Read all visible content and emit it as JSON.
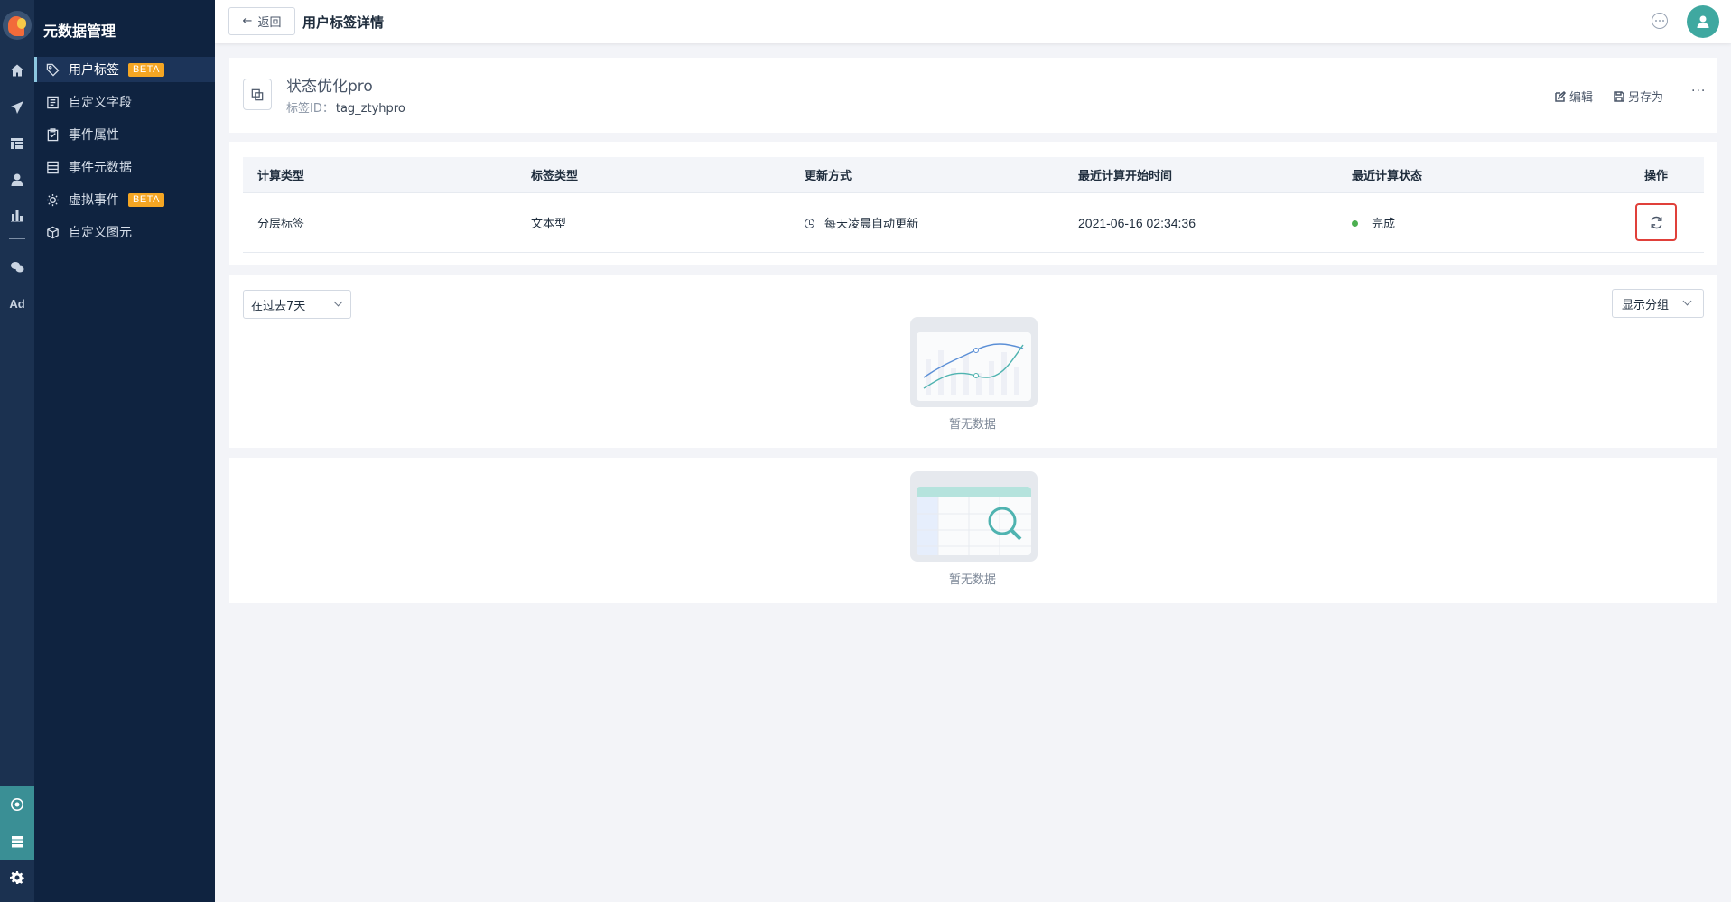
{
  "rail": {
    "icons": [
      "home-icon",
      "send-icon",
      "table-icon",
      "user-icon",
      "bar-chart-icon",
      "wechat-icon",
      "ad-icon"
    ],
    "ad_label": "Ad",
    "bottom_icons": [
      "cluster-icon",
      "server-icon",
      "settings-icon"
    ],
    "colors": {
      "bg": "#1b3150",
      "active_bottom": "#3a8f95"
    }
  },
  "sidebar": {
    "title": "元数据管理",
    "items": [
      {
        "label": "用户标签",
        "badge": "BETA",
        "active": true,
        "icon": "tag-icon"
      },
      {
        "label": "自定义字段",
        "badge": "",
        "active": false,
        "icon": "form-icon"
      },
      {
        "label": "事件属性",
        "badge": "",
        "active": false,
        "icon": "clipboard-icon"
      },
      {
        "label": "事件元数据",
        "badge": "",
        "active": false,
        "icon": "list-icon"
      },
      {
        "label": "虚拟事件",
        "badge": "BETA",
        "active": false,
        "icon": "virtual-icon"
      },
      {
        "label": "自定义图元",
        "badge": "",
        "active": false,
        "icon": "cube-icon"
      }
    ]
  },
  "header": {
    "back_label": "返回",
    "title": "用户标签详情"
  },
  "tag": {
    "name": "状态优化pro",
    "id_label": "标签ID：",
    "id_value": "tag_ztyhpro",
    "edit_label": "编辑",
    "save_as_label": "另存为",
    "more_label": "···"
  },
  "table": {
    "headers": [
      "计算类型",
      "标签类型",
      "更新方式",
      "最近计算开始时间",
      "最近计算状态",
      "操作"
    ],
    "row": {
      "calc_type": "分层标签",
      "tag_type": "文本型",
      "update_mode": "每天凌晨自动更新",
      "last_start": "2021-06-16 02:34:36",
      "status": "完成"
    },
    "colors": {
      "status_ok": "#4caf50",
      "highlight": "#e0403a"
    }
  },
  "chart_panel": {
    "range_select": "在过去7天",
    "group_select": "显示分组",
    "empty_text": "暂无数据"
  },
  "table_panel": {
    "empty_text": "暂无数据"
  }
}
